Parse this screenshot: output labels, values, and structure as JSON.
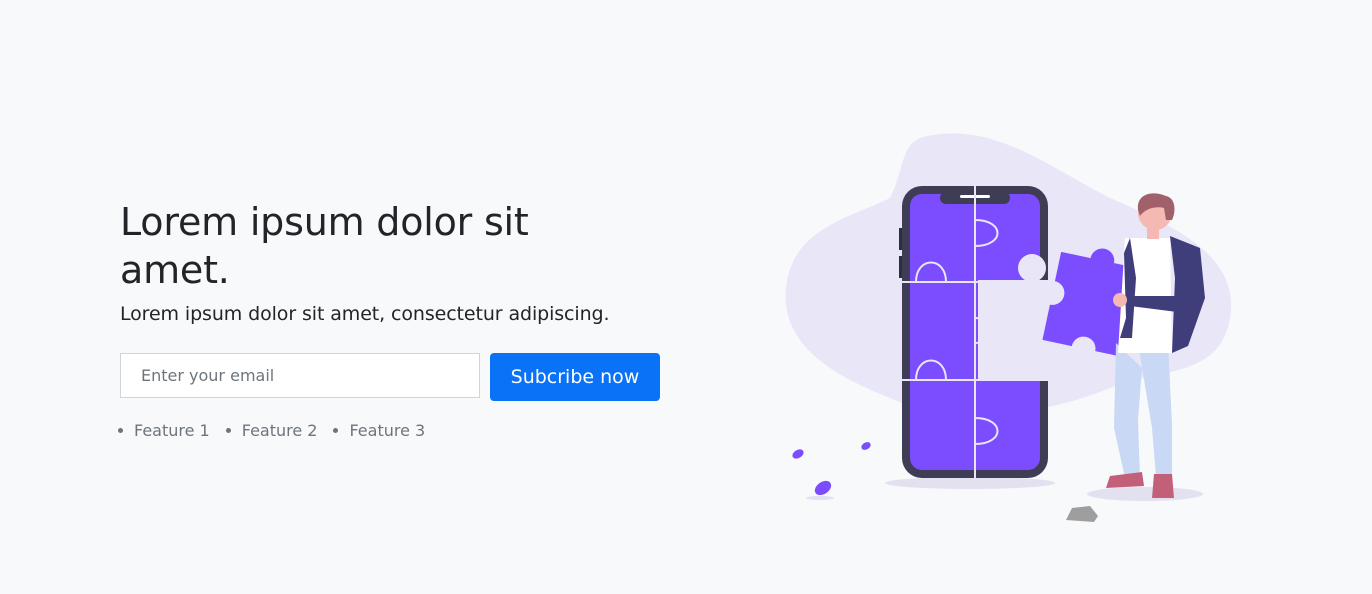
{
  "hero": {
    "headline": "Lorem ipsum dolor sit amet.",
    "subheadline": "Lorem ipsum dolor sit amet, consectetur adipiscing.",
    "email_placeholder": "Enter your email",
    "email_value": "",
    "subscribe_label": "Subcribe now",
    "features": [
      "Feature 1",
      "Feature 2",
      "Feature 3"
    ]
  },
  "illustration": {
    "subject": "person-assembling-puzzle-phone-illustration",
    "colors": {
      "accent": "#7c4dff",
      "phone": "#3f3d56",
      "blob": "#e9e6f8",
      "button": "#0a72f6"
    }
  }
}
